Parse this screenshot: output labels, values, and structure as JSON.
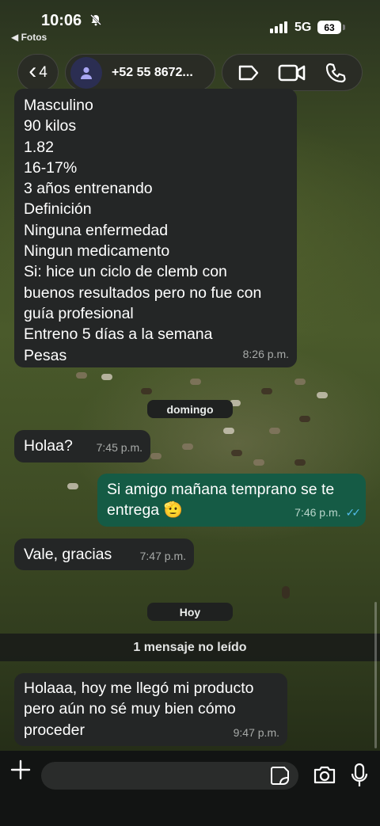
{
  "status_bar": {
    "time": "10:06",
    "back_app": "◀ Fotos",
    "network": "5G",
    "battery": "63"
  },
  "header": {
    "unread_count": "4",
    "contact": "+52 55 8672...",
    "icons": [
      "back-chevron",
      "avatar-person",
      "label-tag",
      "video-call",
      "voice-call"
    ]
  },
  "messages": {
    "m1": {
      "text": "Masculino\n90 kilos\n1.82\n16-17%\n3 años entrenando\nDefinición\nNinguna enfermedad\nNingun medicamento\nSi: hice un ciclo de clemb con buenos resultados pero no fue con guía profesional\nEntreno 5 días a la semana\nPesas",
      "time": "8:26 p.m."
    },
    "day1": "domingo",
    "m2": {
      "text": "Holaa?",
      "time": "7:45 p.m."
    },
    "m3": {
      "text": "Si amigo mañana temprano se te entrega 🫡",
      "time": "7:46 p.m.",
      "ticks": "✓✓"
    },
    "m4": {
      "text": "Vale, gracias",
      "time": "7:47 p.m."
    },
    "day2": "Hoy",
    "unread_banner": "1 mensaje no leído",
    "m5": {
      "text": "Holaaa, hoy me llegó mi producto pero aún no sé muy bien cómo proceder",
      "time": "9:47 p.m."
    }
  },
  "colors": {
    "incoming_bubble": "#242626",
    "outgoing_bubble": "#155b45",
    "read_ticks": "#53bdeb"
  }
}
